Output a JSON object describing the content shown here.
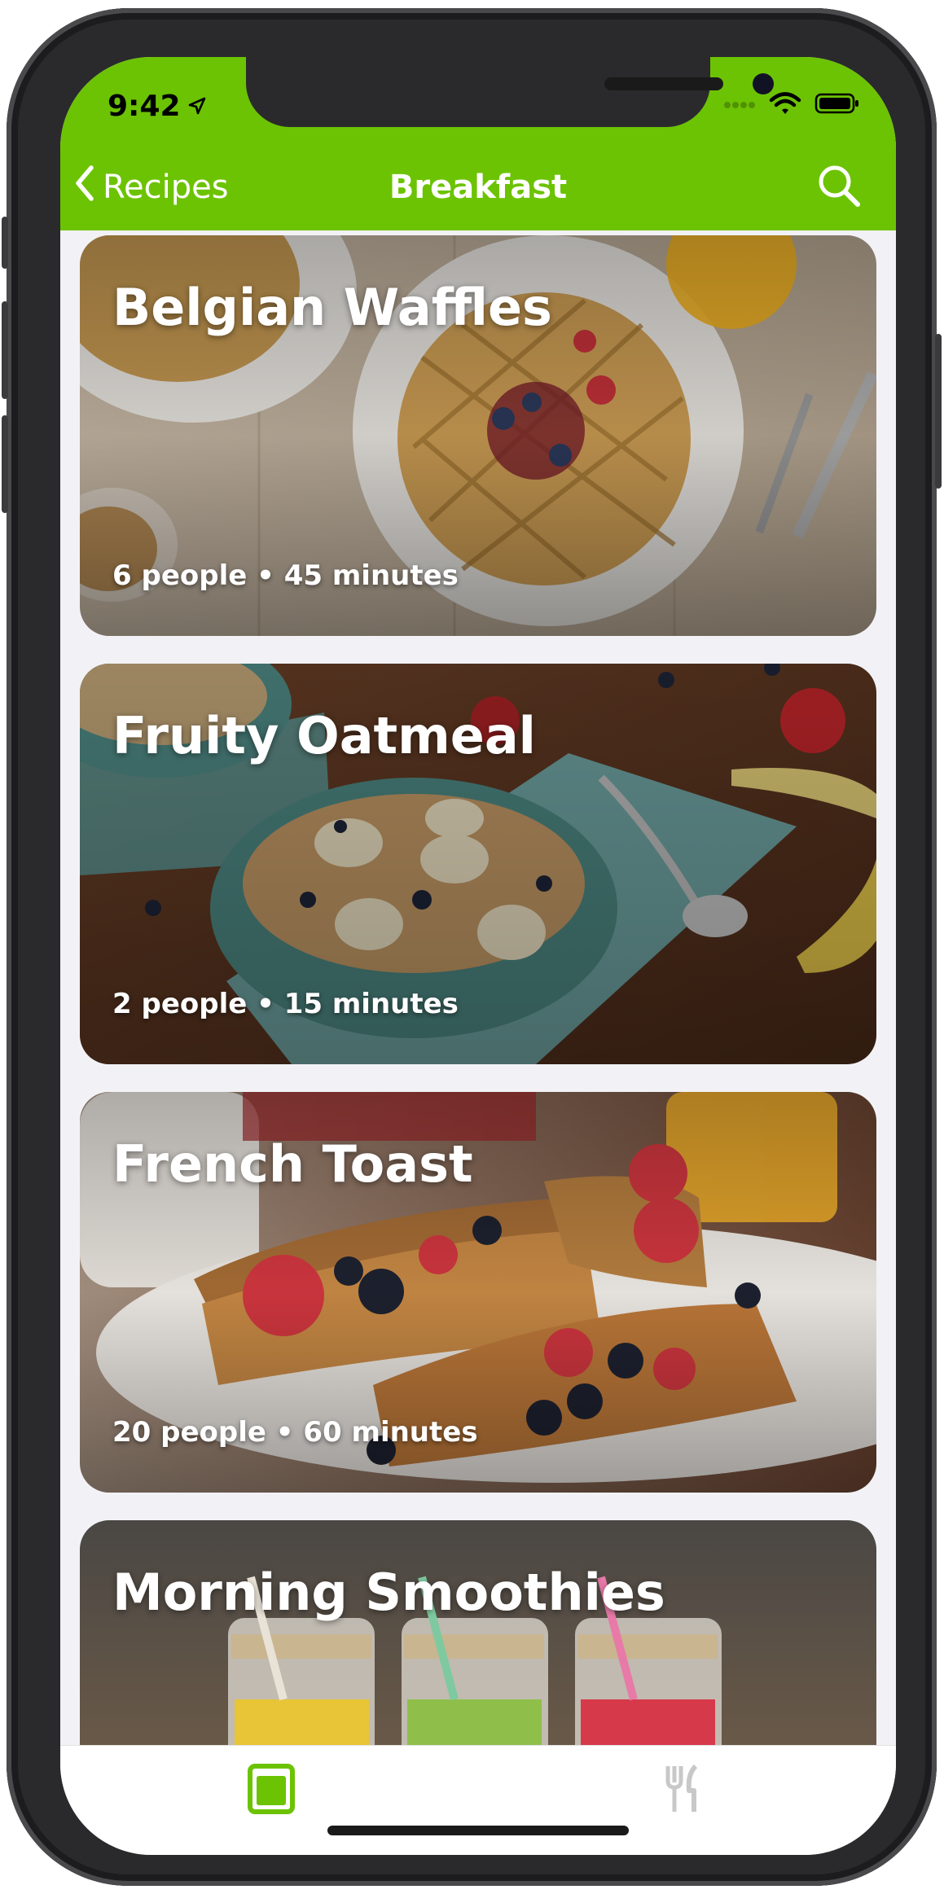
{
  "status_bar": {
    "time": "9:42"
  },
  "nav": {
    "back_label": "Recipes",
    "title": "Breakfast"
  },
  "recipes": [
    {
      "title": "Belgian Waffles",
      "meta": "6 people • 45 minutes"
    },
    {
      "title": "Fruity Oatmeal",
      "meta": "2 people • 15 minutes"
    },
    {
      "title": "French Toast",
      "meta": "20 people • 60 minutes"
    },
    {
      "title": "Morning Smoothies"
    }
  ],
  "tabs": [
    {
      "icon": "recipe-book-icon",
      "active": true
    },
    {
      "icon": "fork-knife-icon",
      "active": false
    }
  ],
  "colors": {
    "accent": "#6cc303",
    "inactive_tab": "#c8c8c8"
  }
}
